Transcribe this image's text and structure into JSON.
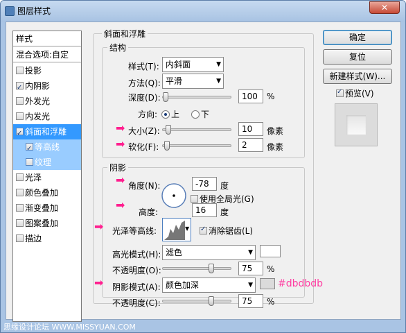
{
  "window": {
    "title": "图层样式",
    "close": "✕"
  },
  "watermark": "思缘设计论坛 WWW.MISSYUAN.COM",
  "left": {
    "header": "样式",
    "blend": "混合选项:自定",
    "items": [
      {
        "label": "投影",
        "checked": false
      },
      {
        "label": "内阴影",
        "checked": true
      },
      {
        "label": "外发光",
        "checked": false
      },
      {
        "label": "内发光",
        "checked": false
      },
      {
        "label": "斜面和浮雕",
        "checked": true
      },
      {
        "label": "等高线",
        "checked": true
      },
      {
        "label": "纹理",
        "checked": false
      },
      {
        "label": "光泽",
        "checked": false
      },
      {
        "label": "颜色叠加",
        "checked": false
      },
      {
        "label": "渐变叠加",
        "checked": false
      },
      {
        "label": "图案叠加",
        "checked": false
      },
      {
        "label": "描边",
        "checked": false
      }
    ]
  },
  "bevel": {
    "title": "斜面和浮雕",
    "structure": "结构",
    "style_label": "样式(T):",
    "style_value": "内斜面",
    "technique_label": "方法(Q):",
    "technique_value": "平滑",
    "depth_label": "深度(D):",
    "depth_value": "100",
    "depth_unit": "%",
    "depth_level": 0.0,
    "direction_label": "方向:",
    "dir_up": "上",
    "dir_down": "下",
    "size_label": "大小(Z):",
    "size_value": "10",
    "size_unit": "像素",
    "size_level": 0.04,
    "soften_label": "软化(F):",
    "soften_value": "2",
    "soften_unit": "像素",
    "soften_level": 0.02
  },
  "shading": {
    "title": "阴影",
    "angle_label": "角度(N):",
    "angle_value": "-78",
    "angle_unit": "度",
    "global_light_label": "使用全局光(G)",
    "altitude_label": "高度:",
    "altitude_value": "16",
    "altitude_unit": "度",
    "gloss_label": "光泽等高线:",
    "antialias_label": "消除锯齿(L)",
    "highlight_mode_label": "高光模式(H):",
    "highlight_mode_value": "滤色",
    "highlight_color": "#ffffff",
    "highlight_opacity_label": "不透明度(O):",
    "highlight_opacity_value": "75",
    "highlight_opacity_unit": "%",
    "highlight_opacity_level": 0.75,
    "shadow_mode_label": "阴影模式(A):",
    "shadow_mode_value": "颜色加深",
    "shadow_color": "#dbdbdb",
    "shadow_opacity_label": "不透明度(C):",
    "shadow_opacity_value": "75",
    "shadow_opacity_unit": "%",
    "shadow_opacity_level": 0.75,
    "color_note": "#dbdbdb"
  },
  "buttons": {
    "ok": "确定",
    "reset": "复位",
    "new_style": "新建样式(W)...",
    "preview": "预览(V)"
  }
}
